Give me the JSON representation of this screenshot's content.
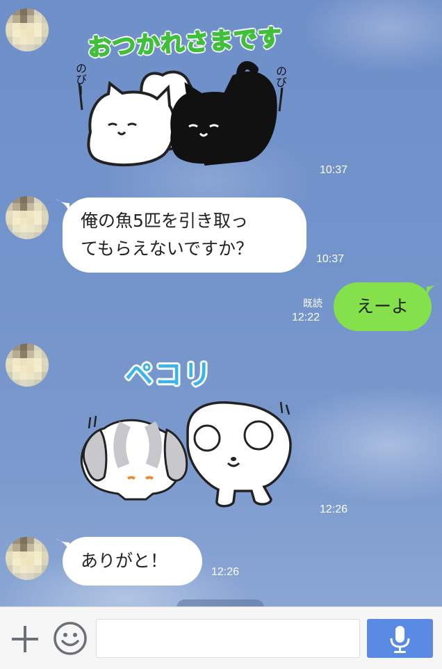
{
  "messages": [
    {
      "type": "sticker",
      "sender": "other",
      "title": "おつかれさまです",
      "side_text_left": "のびー",
      "side_text_right": "のびー",
      "time": "10:37"
    },
    {
      "type": "text",
      "sender": "other",
      "line1": "俺の魚5匹を引き取っ",
      "line2": "てもらえないですか？",
      "time": "10:37"
    },
    {
      "type": "text",
      "sender": "me",
      "text": "えーよ",
      "read": "既読",
      "time": "12:22"
    },
    {
      "type": "sticker",
      "sender": "other",
      "title": "ペコリ",
      "time": "12:26"
    },
    {
      "type": "text",
      "sender": "other",
      "text": "ありがと！",
      "time": "12:26"
    }
  ],
  "input": {
    "placeholder": ""
  },
  "icons": {
    "add": "plus-icon",
    "emoji": "smiley-icon",
    "voice": "microphone-icon"
  },
  "colors": {
    "my_bubble": "#84e04b",
    "other_bubble": "#ffffff",
    "mic_button": "#5b8ae4",
    "sticker_title_green": "#3fbf3a",
    "sticker_title_blue": "#3bb4e8"
  }
}
